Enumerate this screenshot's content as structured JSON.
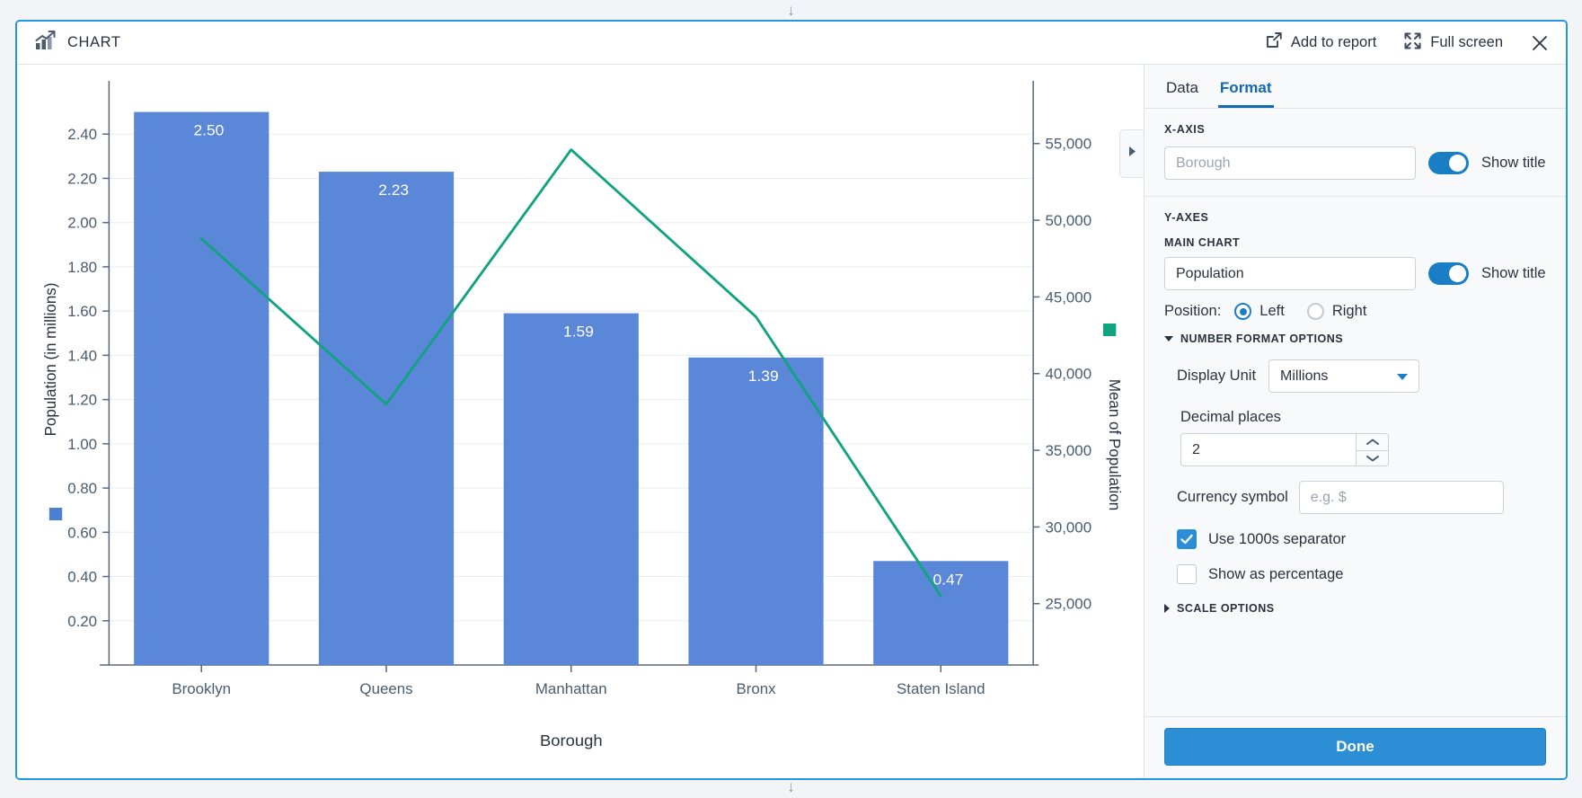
{
  "header": {
    "icon": "bar-chart-icon",
    "title": "CHART",
    "add_to_report_label": "Add to report",
    "add_to_report_icon": "external-link-icon",
    "full_screen_label": "Full screen",
    "full_screen_icon": "expand-icon",
    "close_icon": "close-icon"
  },
  "drag_handles": {
    "top_icon": "↓",
    "bottom_icon": "↓"
  },
  "panel": {
    "tabs": [
      {
        "id": "data",
        "label": "Data",
        "active": false
      },
      {
        "id": "format",
        "label": "Format",
        "active": true
      }
    ],
    "x_axis": {
      "section_label": "X-AXIS",
      "title_value": "",
      "title_placeholder": "Borough",
      "show_title_label": "Show title",
      "show_title_on": true
    },
    "y_axes": {
      "section_label": "Y-AXES",
      "main_chart_label": "MAIN CHART",
      "title_value": "Population",
      "title_placeholder": "",
      "show_title_label": "Show title",
      "show_title_on": true,
      "position_label": "Position:",
      "position_options": [
        {
          "label": "Left",
          "selected": true
        },
        {
          "label": "Right",
          "selected": false
        }
      ]
    },
    "number_format": {
      "heading": "NUMBER FORMAT OPTIONS",
      "expanded": true,
      "display_unit_label": "Display Unit",
      "display_unit_value": "Millions",
      "decimal_places_label": "Decimal places",
      "decimal_places_value": "2",
      "currency_symbol_label": "Currency symbol",
      "currency_symbol_value": "",
      "currency_symbol_placeholder": "e.g. $",
      "use_1000s_separator_label": "Use 1000s separator",
      "use_1000s_separator_checked": true,
      "show_as_percentage_label": "Show as percentage",
      "show_as_percentage_checked": false
    },
    "scale_options": {
      "heading": "SCALE OPTIONS",
      "expanded": false
    },
    "done_label": "Done",
    "expand_handle_icon": "chevron-right-icon"
  },
  "chart_data": {
    "type": "bar",
    "title": "",
    "categories": [
      "Brooklyn",
      "Queens",
      "Manhattan",
      "Bronx",
      "Staten Island"
    ],
    "xlabel": "Borough",
    "grid": true,
    "legend": "none",
    "series": [
      {
        "name": "Population",
        "type": "bar",
        "axis": "left",
        "color": "#5b87d9",
        "values": [
          2.5,
          2.23,
          1.59,
          1.39,
          0.47
        ],
        "labels": [
          "2.50",
          "2.23",
          "1.59",
          "1.39",
          "0.47"
        ],
        "label_color": "#ffffff"
      },
      {
        "name": "Mean of Population",
        "type": "line",
        "axis": "right",
        "color": "#10a37f",
        "values": [
          48800,
          38000,
          54600,
          43700,
          25500
        ]
      }
    ],
    "left_axis": {
      "title": "Population (in millions)",
      "ticks": [
        "0.20",
        "0.40",
        "0.60",
        "0.80",
        "1.00",
        "1.20",
        "1.40",
        "1.60",
        "1.80",
        "2.00",
        "2.20",
        "2.40"
      ],
      "tick_values": [
        0.2,
        0.4,
        0.6,
        0.8,
        1.0,
        1.2,
        1.4,
        1.6,
        1.8,
        2.0,
        2.2,
        2.4
      ],
      "ylim": [
        0,
        2.6
      ],
      "swatch_color": "#4a7fd4"
    },
    "right_axis": {
      "title": "Mean of Population",
      "ticks": [
        "25,000",
        "30,000",
        "35,000",
        "40,000",
        "45,000",
        "50,000",
        "55,000"
      ],
      "tick_values": [
        25000,
        30000,
        35000,
        40000,
        45000,
        50000,
        55000
      ],
      "ylim": [
        21000,
        58500
      ],
      "swatch_color": "#10a37f"
    }
  }
}
